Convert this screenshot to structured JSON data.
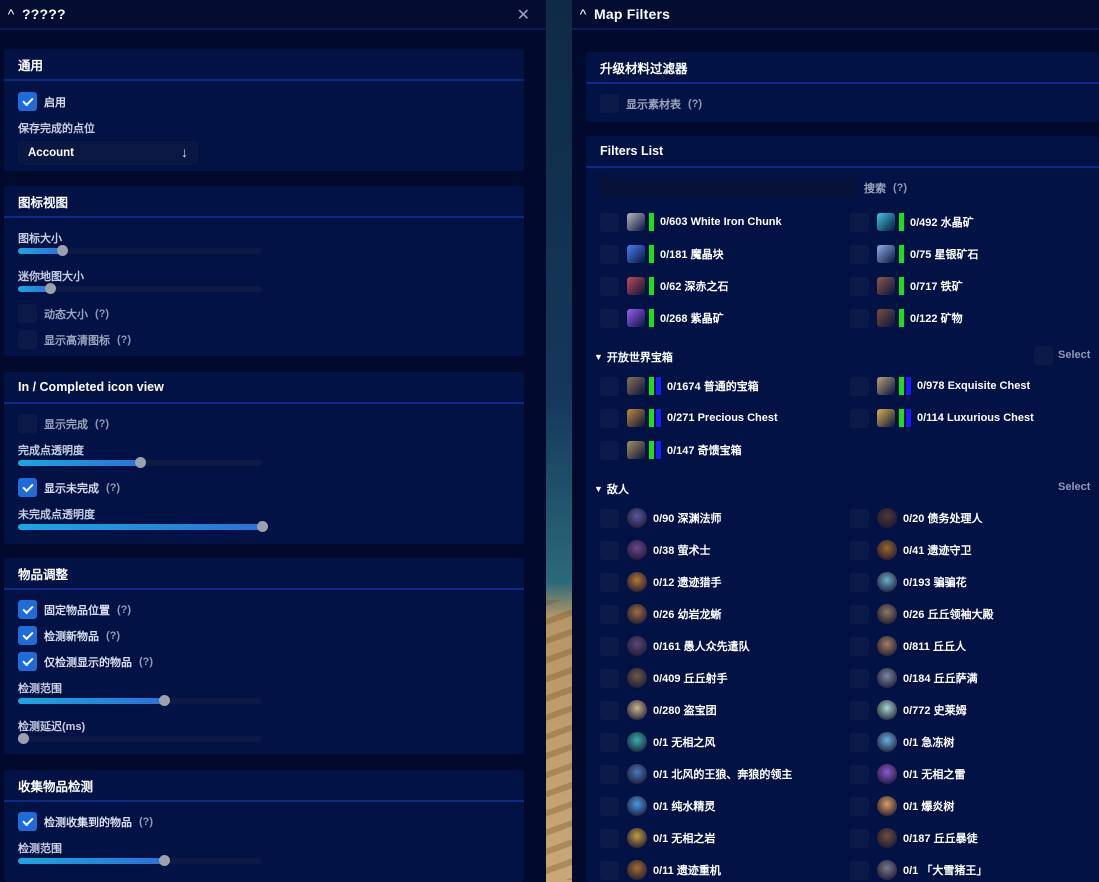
{
  "left": {
    "title": "?????",
    "general": {
      "heading": "通用",
      "enable": "启用",
      "save_label": "保存完成的点位",
      "save_value": "Account"
    },
    "icon_view": {
      "heading": "图标视图",
      "icon_size": "图标大小",
      "icon_size_value": 0.18,
      "minimap_size": "迷你地图大小",
      "minimap_size_value": 0.13,
      "dynamic_size": "动态大小",
      "hd_icons": "显示高清图标"
    },
    "completed_view": {
      "heading": "In / Completed icon view",
      "show_completed": "显示完成",
      "completed_opacity": "完成点透明度",
      "completed_opacity_value": 0.5,
      "show_uncompleted": "显示未完成",
      "uncompleted_opacity": "未完成点透明度",
      "uncompleted_opacity_value": 1.0
    },
    "item_adjust": {
      "heading": "物品调整",
      "fix_position": "固定物品位置",
      "detect_new": "检测新物品",
      "detect_shown": "仅检测显示的物品",
      "detect_range": "检测范围",
      "detect_range_value": 0.6,
      "detect_delay": "检测延迟(ms)",
      "detect_delay_value": 0.02
    },
    "collect_detect": {
      "heading": "收集物品检测",
      "detect_collected": "检测收集到的物品",
      "detect_range": "检测范围",
      "detect_range_value": 0.6
    },
    "help": "(?)"
  },
  "right": {
    "title": "Map Filters",
    "upgrade": {
      "heading": "升级材料过滤器",
      "show_table": "显示素材表"
    },
    "filters": {
      "heading": "Filters List",
      "search_label": "搜索",
      "ores": [
        {
          "text": "0/603  White Iron Chunk",
          "icon": "white-iron-icon",
          "color": "#b7b8c2"
        },
        {
          "text": "0/492  水晶矿",
          "icon": "crystal-icon",
          "color": "#3fc9e0"
        },
        {
          "text": "0/181  魔晶块",
          "icon": "magical-crystal-icon",
          "color": "#4a7ff0"
        },
        {
          "text": "0/75  星银矿石",
          "icon": "starsilver-icon",
          "color": "#8fb1e8"
        },
        {
          "text": "0/62  深赤之石",
          "icon": "crimson-stone-icon",
          "color": "#c04a55"
        },
        {
          "text": "0/717  铁矿",
          "icon": "iron-ore-icon",
          "color": "#8d5a4a"
        },
        {
          "text": "0/268  紫晶矿",
          "icon": "amethyst-icon",
          "color": "#9b5ff0"
        },
        {
          "text": "0/122  矿物",
          "icon": "mineral-icon",
          "color": "#7a4e40"
        }
      ],
      "chests_heading": "开放世界宝箱",
      "chests": [
        {
          "text": "0/1674  普通的宝箱",
          "icon": "common-chest-icon",
          "color": "#8a7356"
        },
        {
          "text": "0/978  Exquisite Chest",
          "icon": "exquisite-chest-icon",
          "color": "#b8a27a"
        },
        {
          "text": "0/271  Precious Chest",
          "icon": "precious-chest-icon",
          "color": "#c08a3a"
        },
        {
          "text": "0/114  Luxurious Chest",
          "icon": "luxurious-chest-icon",
          "color": "#d9b24f"
        },
        {
          "text": "0/147  奇馈宝箱",
          "icon": "remarkable-chest-icon",
          "color": "#a89060"
        }
      ],
      "enemies_heading": "敌人",
      "select": "Select",
      "enemies": [
        {
          "text": "0/90  深渊法师",
          "icon": "abyss-mage-icon",
          "color": "#5b5a9a"
        },
        {
          "text": "0/20  债务处理人",
          "icon": "debt-collector-icon",
          "color": "#4a3a3a"
        },
        {
          "text": "0/38  萤术士",
          "icon": "cicin-mage-icon",
          "color": "#6a4a8a"
        },
        {
          "text": "0/41  遗迹守卫",
          "icon": "ruin-guard-icon",
          "color": "#9a6a2a"
        },
        {
          "text": "0/12  遗迹猎手",
          "icon": "ruin-hunter-icon",
          "color": "#b07a30"
        },
        {
          "text": "0/193  骗骗花",
          "icon": "whopperflower-icon",
          "color": "#6ab0c8"
        },
        {
          "text": "0/26  幼岩龙蜥",
          "icon": "geovishap-icon",
          "color": "#9a7040"
        },
        {
          "text": "0/26  丘丘领袖大殿",
          "icon": "hilichurl-lord-icon",
          "color": "#8a7a60"
        },
        {
          "text": "0/161  愚人众先遣队",
          "icon": "fatui-skirmisher-icon",
          "color": "#5a4a7a"
        },
        {
          "text": "0/811  丘丘人",
          "icon": "hilichurl-icon",
          "color": "#a08060"
        },
        {
          "text": "0/409  丘丘射手",
          "icon": "hilichurl-shooter-icon",
          "color": "#6a5a4a"
        },
        {
          "text": "0/184  丘丘萨满",
          "icon": "samachurl-icon",
          "color": "#7a8aa0"
        },
        {
          "text": "0/280  盗宝团",
          "icon": "treasure-hoarder-icon",
          "color": "#c8b890"
        },
        {
          "text": "0/772  史莱姆",
          "icon": "slime-icon",
          "color": "#a8d8d0"
        },
        {
          "text": "0/1  无相之风",
          "icon": "anemo-hypostasis-icon",
          "color": "#3ab0b0"
        },
        {
          "text": "0/1  急冻树",
          "icon": "cryo-regisvine-icon",
          "color": "#6ab0e0"
        },
        {
          "text": "0/1  北风的王狼、奔狼的领主",
          "icon": "andrius-icon",
          "color": "#4a7ab8"
        },
        {
          "text": "0/1  无相之雷",
          "icon": "electro-hypostasis-icon",
          "color": "#8a5ad0"
        },
        {
          "text": "0/1  纯水精灵",
          "icon": "oceanid-icon",
          "color": "#4a9ae0"
        },
        {
          "text": "0/1  爆炎树",
          "icon": "pyro-regisvine-icon",
          "color": "#d8a060"
        },
        {
          "text": "0/1  无相之岩",
          "icon": "geo-hypostasis-icon",
          "color": "#c0a040"
        },
        {
          "text": "0/187  丘丘暴徒",
          "icon": "mitachurl-icon",
          "color": "#6a5040"
        },
        {
          "text": "0/11  遗迹重机",
          "icon": "ruin-grader-icon",
          "color": "#a07030"
        },
        {
          "text": "0/1  「大雪猪王」",
          "icon": "boar-king-icon",
          "color": "#7a7a8a"
        }
      ]
    },
    "help": "(?)"
  }
}
